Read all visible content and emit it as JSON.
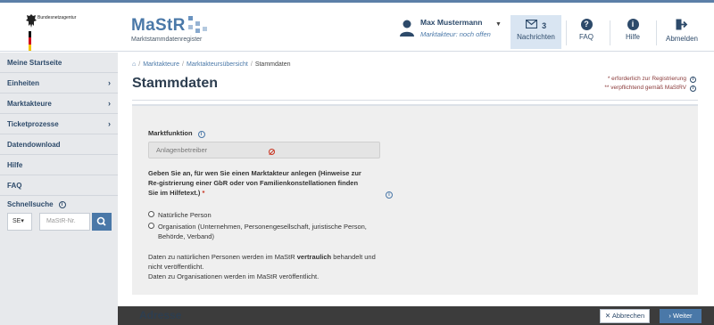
{
  "header": {
    "agency": "Bundesnetzagentur",
    "logo_name": "MaStR",
    "logo_subtitle": "Marktstammdatenregister",
    "user_name": "Max Mustermann",
    "user_role": "Marktakteur: noch offen",
    "messages_count": "3",
    "messages_label": "Nachrichten",
    "faq_label": "FAQ",
    "help_label": "Hilfe",
    "logout_label": "Abmelden"
  },
  "sidebar": {
    "items": [
      {
        "label": "Meine Startseite"
      },
      {
        "label": "Einheiten"
      },
      {
        "label": "Marktakteure"
      },
      {
        "label": "Ticketprozesse"
      },
      {
        "label": "Datendownload"
      },
      {
        "label": "Hilfe"
      },
      {
        "label": "FAQ"
      }
    ],
    "quick_search_label": "Schnellsuche",
    "quick_search_select": "SE",
    "quick_search_placeholder": "MaStR-Nr."
  },
  "main": {
    "breadcrumb": [
      "Marktakteure",
      "Marktakteursübersicht",
      "Stammdaten"
    ],
    "title": "Stammdaten",
    "legend_required": "* erforderlich zur Registrierung",
    "legend_mandatory": "** verpflichtend gemäß MaStRV",
    "market_function_label": "Marktfunktion",
    "market_function_value": "Anlagenbetreiber",
    "question": "Geben Sie an, für wen Sie einen Marktakteur anlegen (Hinweise zur Re-gistrierung einer GbR oder von Familienkonstellationen finden Sie im Hilfetext.)",
    "question_required": "*",
    "option_natural": "Natürliche Person",
    "option_org": "Organisation (Unternehmen, Personengesellschaft, juristische Person, Behörde, Verband)",
    "note_part1": "Daten zu natürlichen Personen werden im MaStR ",
    "note_bold": "vertraulich",
    "note_part2": " behandelt und nicht veröffentlicht.",
    "note_line2": "Daten zu Organisationen werden im MaStR veröffentlicht.",
    "section_next": "Adresse",
    "cancel_label": "Abbrechen",
    "next_label": "Weiter"
  },
  "colors": {
    "accent": "#4a78a8",
    "dark_text": "#2d4a6a",
    "required_red": "#c8321e"
  }
}
